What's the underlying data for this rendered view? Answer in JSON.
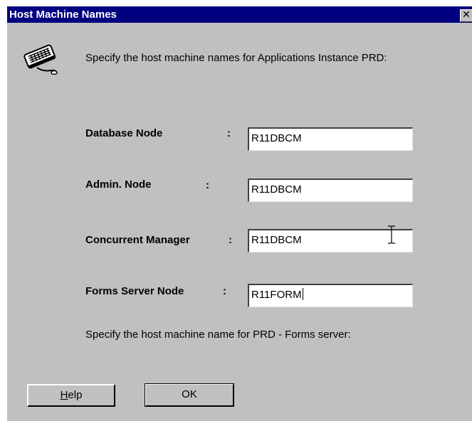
{
  "window": {
    "title": "Host Machine Names",
    "close_glyph": "✕"
  },
  "icons": {
    "keyboard": "keyboard-icon",
    "close": "close-icon",
    "text_cursor": "ibeam-cursor-icon"
  },
  "instruction": "Specify the host machine names for Applications Instance PRD:",
  "fields": [
    {
      "label": "Database Node",
      "colon": ":",
      "value": "R11DBCM"
    },
    {
      "label": "Admin. Node",
      "colon": ":",
      "value": "R11DBCM"
    },
    {
      "label": "Concurrent Manager",
      "colon": ":",
      "value": "R11DBCM"
    },
    {
      "label": "Forms Server Node",
      "colon": ":",
      "value": "R11FORM"
    }
  ],
  "note": "Specify the host machine name for PRD - Forms server:",
  "buttons": {
    "help_label_mnemonic": "H",
    "help_label_rest": "elp",
    "ok_label": "OK"
  },
  "colors": {
    "title_bar": "#000080",
    "dialog_face": "#c0c0c0",
    "field_bg": "#ffffff"
  }
}
